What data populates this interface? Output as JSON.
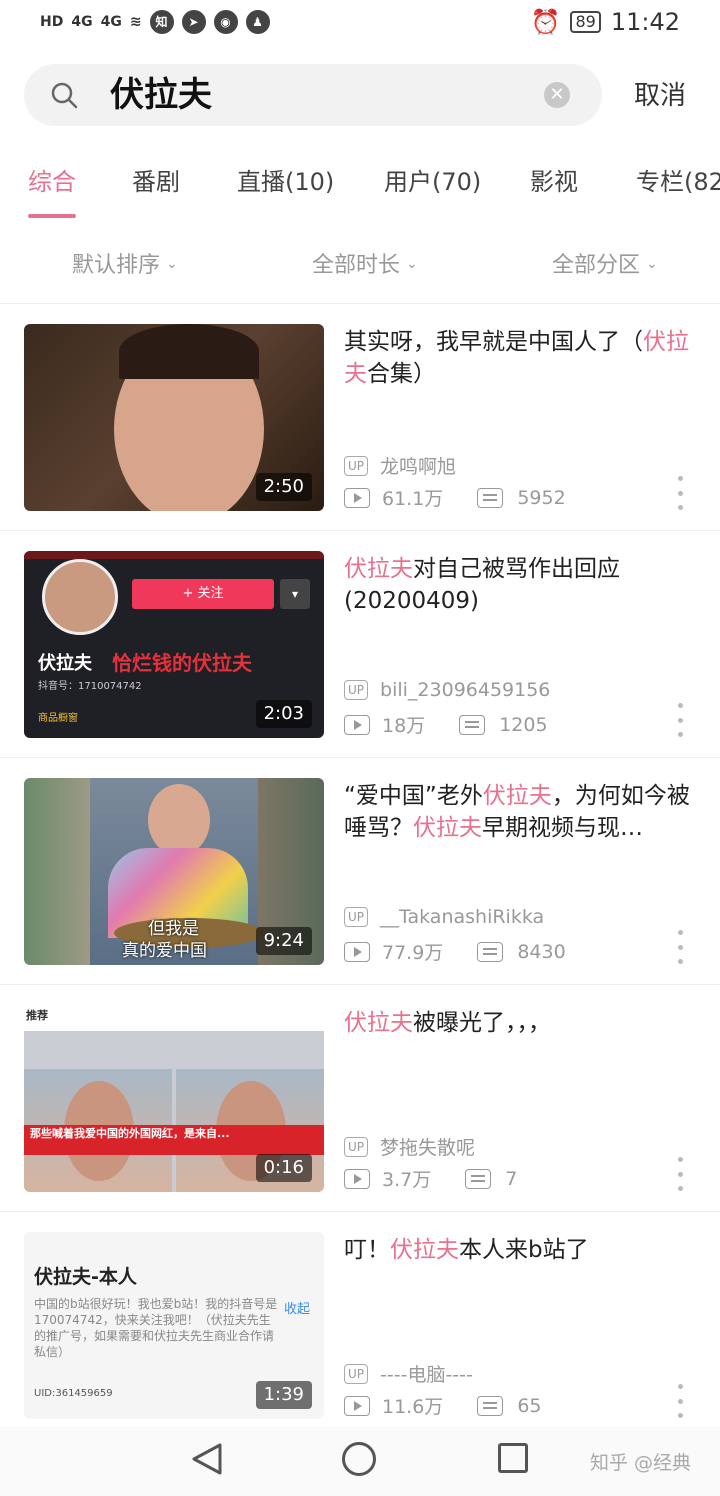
{
  "status_bar": {
    "network_label": "HD",
    "signal_1": "4G",
    "signal_2": "4G",
    "app_badge": "知",
    "battery": "89",
    "time": "11:42"
  },
  "search": {
    "query": "伏拉夫",
    "cancel_label": "取消"
  },
  "tabs": [
    {
      "label": "综合"
    },
    {
      "label": "番剧"
    },
    {
      "label": "直播(10)"
    },
    {
      "label": "用户(70)"
    },
    {
      "label": "影视"
    },
    {
      "label": "专栏(82"
    }
  ],
  "filters": [
    {
      "label": "默认排序"
    },
    {
      "label": "全部时长"
    },
    {
      "label": "全部分区"
    }
  ],
  "results": [
    {
      "title_parts": [
        "其实呀，我早就是中国人了（",
        "伏拉夫",
        "合集）"
      ],
      "up_badge": "UP",
      "uploader": "龙鸣啊旭",
      "views": "61.1万",
      "danmaku": "5952",
      "duration": "2:50"
    },
    {
      "title_parts": [
        "",
        "伏拉夫",
        "对自己被骂作出回应(20200409)"
      ],
      "up_badge": "UP",
      "uploader": "bili_23096459156",
      "views": "18万",
      "danmaku": "1205",
      "duration": "2:03",
      "thumb_name": "伏拉夫",
      "thumb_banner": "恰烂钱的伏拉夫",
      "thumb_id": "抖音号：1710074742",
      "thumb_follow": "+ 关注",
      "thumb_shop": "商品橱窗"
    },
    {
      "title_parts": [
        "“爱中国”老外",
        "伏拉夫",
        "，为何如今被唾骂？",
        "伏拉夫",
        "早期视频与现…"
      ],
      "up_badge": "UP",
      "uploader": "__TakanashiRikka",
      "views": "77.9万",
      "danmaku": "8430",
      "duration": "9:24",
      "thumb_caption_1": "但我是",
      "thumb_caption_2": "真的爱中国"
    },
    {
      "title_parts": [
        "",
        "伏拉夫",
        "被曝光了，，，"
      ],
      "up_badge": "UP",
      "uploader": "梦拖失散呢",
      "views": "3.7万",
      "danmaku": "7",
      "duration": "0:16",
      "thumb_tag": "推荐",
      "thumb_banner": "那些喊着我爱中国的外国网红，是来自..."
    },
    {
      "title_parts": [
        "叮！",
        "伏拉夫",
        "本人来b站了"
      ],
      "up_badge": "UP",
      "uploader": "----电脑----",
      "views": "11.6万",
      "danmaku": "65",
      "duration": "1:39",
      "thumb_name": "伏拉夫-本人",
      "thumb_bio": "中国的b站很好玩！我也爱b站！我的抖音号是170074742，快来关注我吧！（伏拉夫先生的推广号，如果需要和伏拉夫先生商业合作请私信）",
      "thumb_uid": "UID:361459659",
      "thumb_action": "收起"
    }
  ],
  "nav": {
    "watermark": "知乎 @经典"
  },
  "colors": {
    "accent": "#e8728e",
    "muted": "#999999"
  }
}
